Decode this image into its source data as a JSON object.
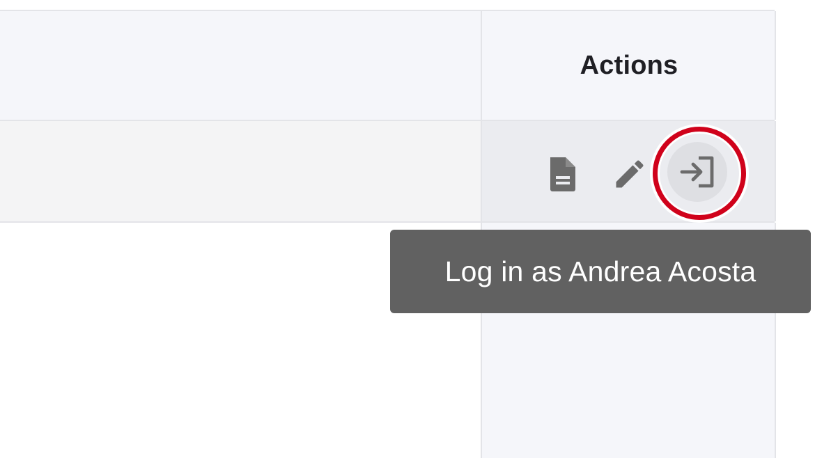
{
  "table": {
    "header": {
      "actions_label": "Actions"
    },
    "row": {
      "actions": [
        {
          "name": "view",
          "icon": "document-icon"
        },
        {
          "name": "edit",
          "icon": "pencil-icon"
        },
        {
          "name": "login",
          "icon": "login-arrow-icon"
        }
      ]
    }
  },
  "tooltip": {
    "text": "Log in as Andrea Acosta"
  },
  "colors": {
    "header_bg": "#f5f6fa",
    "row_bg": "#f4f4f5",
    "icon": "#6b6b6b",
    "highlight": "#d0021b",
    "tooltip_bg": "#616161"
  }
}
